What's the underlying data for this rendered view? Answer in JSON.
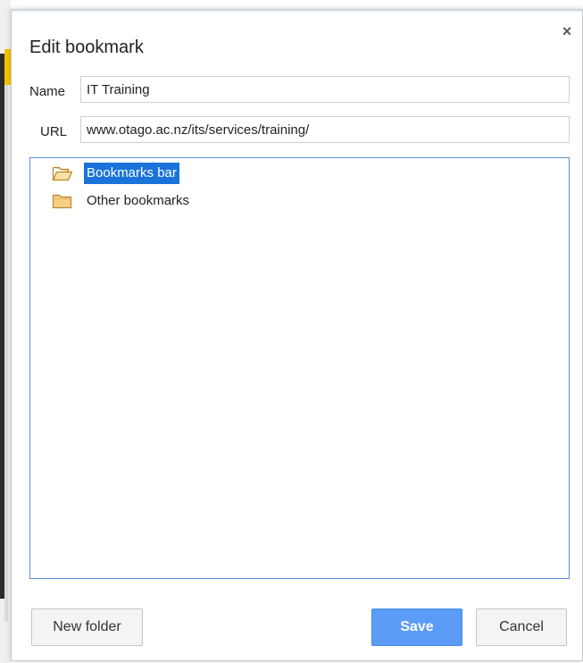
{
  "dialog": {
    "title": "Edit bookmark",
    "close_label": "×"
  },
  "fields": {
    "name_label": "Name",
    "name_value": "IT Training",
    "url_label": "URL",
    "url_value": "www.otago.ac.nz/its/services/training/"
  },
  "tree": {
    "items": [
      {
        "label": "Bookmarks bar",
        "icon": "folder-open-icon",
        "selected": true
      },
      {
        "label": "Other bookmarks",
        "icon": "folder-icon",
        "selected": false
      }
    ]
  },
  "buttons": {
    "new_folder": "New folder",
    "save": "Save",
    "cancel": "Cancel"
  },
  "colors": {
    "selection": "#1a73d9",
    "primary_button": "#5b9cf7",
    "tree_border": "#5b8fd9",
    "folder_fill": "#f7cf86",
    "folder_stroke": "#b8862f"
  }
}
